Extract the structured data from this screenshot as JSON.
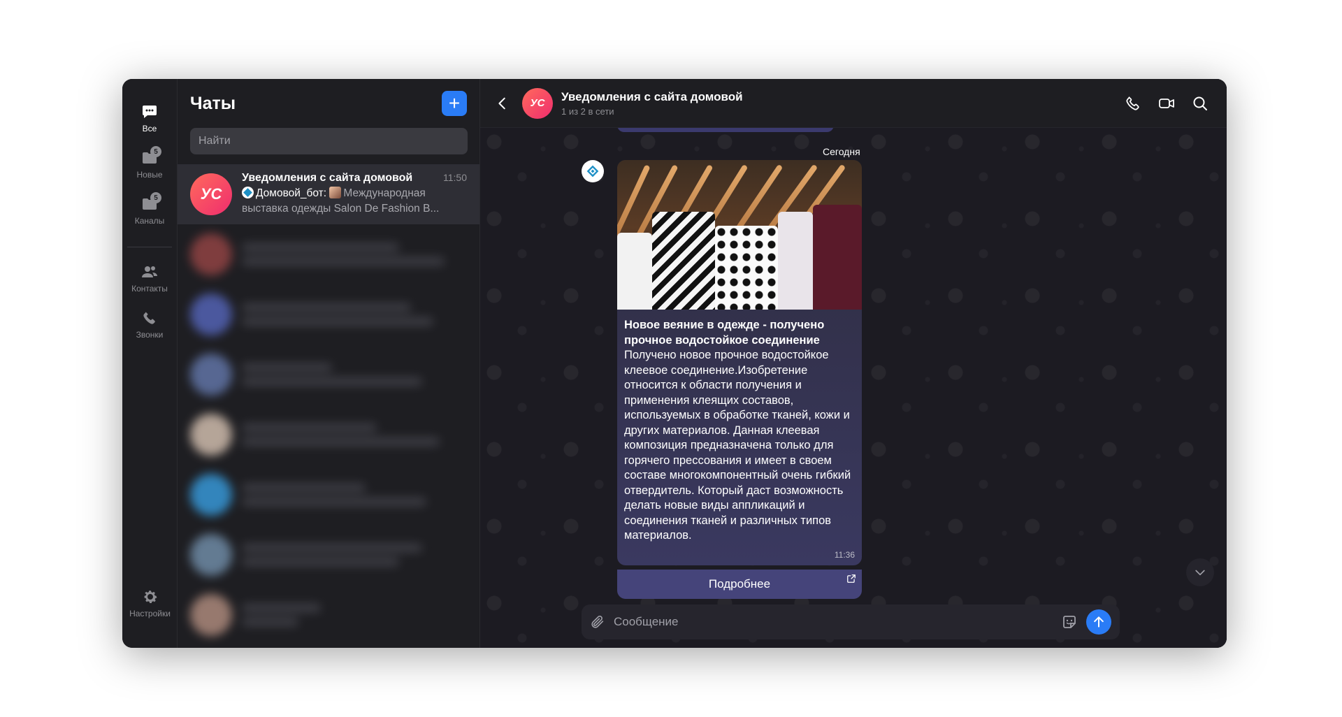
{
  "rail": {
    "items": [
      {
        "label": "Все",
        "icon": "chat-bubble-icon",
        "badge": ""
      },
      {
        "label": "Новые",
        "icon": "folder-icon",
        "badge": "5"
      },
      {
        "label": "Каналы",
        "icon": "folder-icon",
        "badge": "5"
      },
      {
        "label": "Контакты",
        "icon": "contacts-icon",
        "badge": ""
      },
      {
        "label": "Звонки",
        "icon": "phone-icon",
        "badge": ""
      }
    ],
    "settings_label": "Настройки"
  },
  "chatlist": {
    "title": "Чаты",
    "add_symbol": "+",
    "search_placeholder": "Найти",
    "active_chat": {
      "avatar_initials": "УС",
      "name": "Уведомления с сайта домовой",
      "time": "11:50",
      "sender": "Домовой_бот:",
      "preview": "Международная выставка одежды Salon De Fashion B..."
    }
  },
  "conversation": {
    "avatar_initials": "УС",
    "title": "Уведомления с сайта домовой",
    "status": "1 из 2 в сети",
    "date_label": "Сегодня",
    "message": {
      "title": "Новое веяние в одежде - получено прочное водостойкое соединение",
      "body": "Получено новое прочное водостойкое клеевое соединение.Изобретение относится к области получения и применения клеящих составов, используемых в обработке тканей, кожи и других материалов. Данная клеевая композиция предназначена только для горячего прессования и имеет в своем составе многокомпонентный очень гибкий отвердитель. Который даст возможность делать новые виды аппликаций и соединения тканей и различных типов материалов.",
      "time": "11:36",
      "button_label": "Подробнее"
    },
    "composer_placeholder": "Сообщение"
  },
  "colors": {
    "accent": "#2a7cf6",
    "avatar_gradient_start": "#ff6a5c",
    "avatar_gradient_end": "#ef2d6e",
    "button_bg": "#45447a"
  }
}
